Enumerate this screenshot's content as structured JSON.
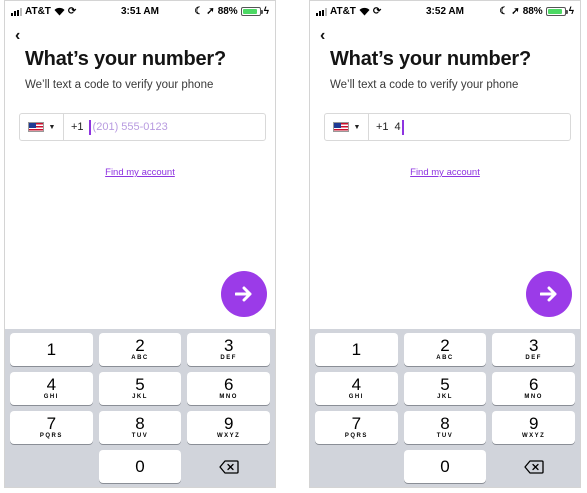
{
  "screens": [
    {
      "status": {
        "carrier": "AT&T",
        "time": "3:51 AM",
        "battery": "88%",
        "battery_level": 0.88
      },
      "back_icon": "‹",
      "title": "What’s your number?",
      "subtitle": "We’ll text a code to verify your phone",
      "phone_input": {
        "country": "US",
        "dial_code": "+1",
        "value": "",
        "placeholder": "(201) 555-0123"
      },
      "find_account": "Find my account",
      "next_icon": "arrow-right-icon"
    },
    {
      "status": {
        "carrier": "AT&T",
        "time": "3:52 AM",
        "battery": "88%",
        "battery_level": 0.88
      },
      "back_icon": "‹",
      "title": "What’s your number?",
      "subtitle": "We’ll text a code to verify your phone",
      "phone_input": {
        "country": "US",
        "dial_code": "+1",
        "value": "4",
        "placeholder": "(201) 555-0123"
      },
      "find_account": "Find my account",
      "next_icon": "arrow-right-icon"
    }
  ],
  "keypad": [
    {
      "digit": "1",
      "letters": ""
    },
    {
      "digit": "2",
      "letters": "ABC"
    },
    {
      "digit": "3",
      "letters": "DEF"
    },
    {
      "digit": "4",
      "letters": "GHI"
    },
    {
      "digit": "5",
      "letters": "JKL"
    },
    {
      "digit": "6",
      "letters": "MNO"
    },
    {
      "digit": "7",
      "letters": "PQRS"
    },
    {
      "digit": "8",
      "letters": "TUV"
    },
    {
      "digit": "9",
      "letters": "WXYZ"
    },
    {
      "digit": "0",
      "letters": ""
    }
  ],
  "colors": {
    "accent": "#9b3be8",
    "link": "#8e34e0",
    "keypad_bg": "#d1d4db",
    "battery": "#4cd964"
  }
}
